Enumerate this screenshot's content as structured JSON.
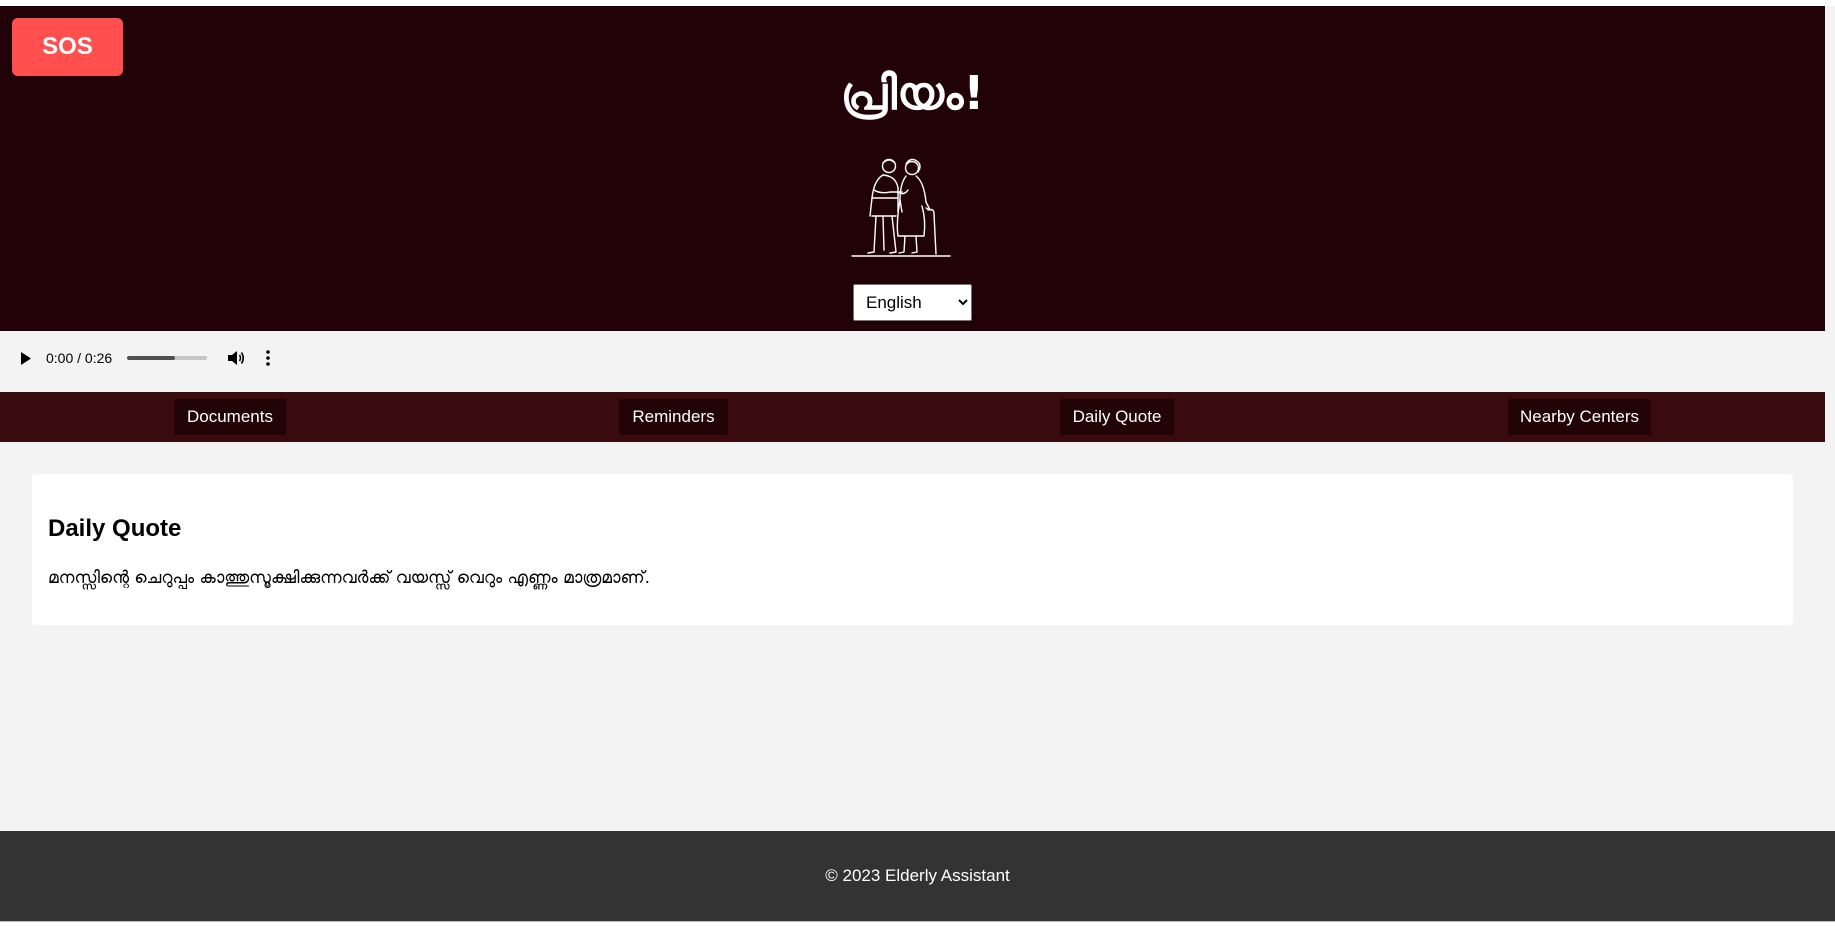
{
  "header": {
    "sos_label": "SOS",
    "app_title": "പ്രിയം!",
    "illustration_icon": "elderly-couple-icon",
    "language": {
      "selected": "English"
    }
  },
  "audio": {
    "time_display": "0:00 / 0:26",
    "progress_fraction": 0.6,
    "icons": [
      "play-icon",
      "volume-icon",
      "more-options-icon"
    ]
  },
  "nav": {
    "items": [
      {
        "label": "Documents"
      },
      {
        "label": "Reminders"
      },
      {
        "label": "Daily Quote"
      },
      {
        "label": "Nearby Centers"
      }
    ]
  },
  "main": {
    "card_title": "Daily Quote",
    "quote": "മനസ്സിന്റെ ചെറുപ്പം കാത്തുസൂക്ഷിക്കുന്നവർക്ക് വയസ്സ് വെറും എണ്ണം മാത്രമാണ്."
  },
  "footer": {
    "text": "© 2023 Elderly Assistant"
  },
  "colors": {
    "header_bg": "#210307",
    "nav_bg": "#3a0b0e",
    "nav_item_bg": "#220306",
    "sos": "#ff4f4f",
    "footer_bg": "#333333",
    "page_bg": "#f3f3f3"
  }
}
